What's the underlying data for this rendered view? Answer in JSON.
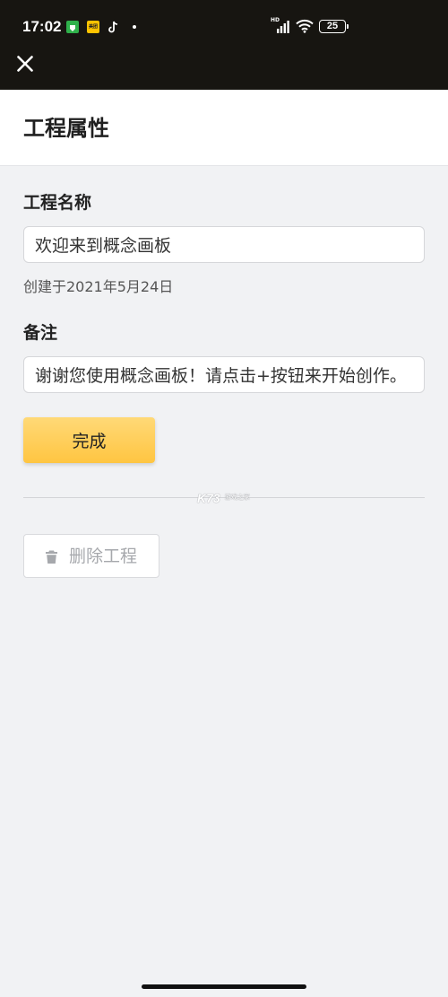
{
  "status_bar": {
    "time": "17:02",
    "notification_icons": [
      "app-green-icon",
      "meituan-icon",
      "tiktok-icon",
      "dot-icon"
    ],
    "meituan_label": "美团",
    "network_label": "HD",
    "battery_level": "25"
  },
  "toolbar": {
    "close_icon": "close-icon"
  },
  "header": {
    "title": "工程属性"
  },
  "form": {
    "name_label": "工程名称",
    "name_value": "欢迎来到概念画板",
    "created_text": "创建于2021年5月24日",
    "note_label": "备注",
    "note_value": "谢谢您使用概念画板！请点击+按钮来开始创作。",
    "done_label": "完成",
    "delete_icon": "trash-icon",
    "delete_label": "删除工程"
  },
  "watermark": {
    "main": "K73",
    "sub": "游戏之家"
  },
  "colors": {
    "topbar": "#171511",
    "background": "#f1f2f4",
    "accent_button": "#ffc541",
    "disabled_text": "#a6a8ac"
  }
}
